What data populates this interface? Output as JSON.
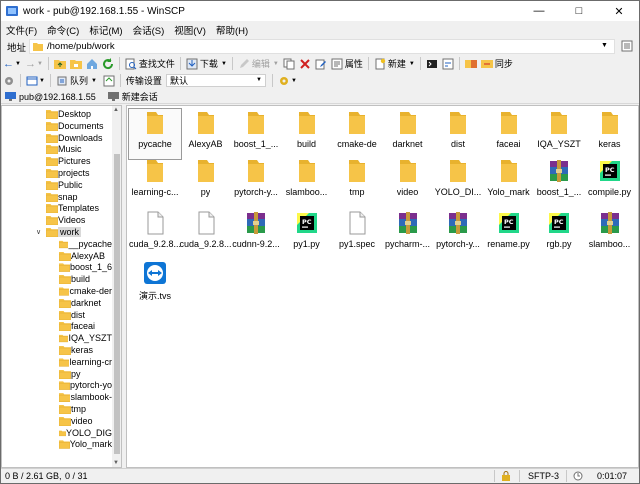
{
  "window": {
    "title": "work - pub@192.168.1.55 - WinSCP"
  },
  "menu": [
    "文件(F)",
    "命令(C)",
    "标记(M)",
    "会话(S)",
    "视图(V)",
    "帮助(H)"
  ],
  "address": {
    "label": "地址",
    "path": "/home/pub/work"
  },
  "toolbar1": {
    "find": "查找文件",
    "download": "下载",
    "edit": "编辑",
    "properties": "属性",
    "new": "新建",
    "sync": "同步"
  },
  "toolbar2": {
    "queue": "队列",
    "transfer_label": "传输设置",
    "transfer_value": "默认"
  },
  "session": {
    "current": "pub@192.168.1.55",
    "new": "新建会话"
  },
  "tree": {
    "top": [
      "Desktop",
      "Documents",
      "Downloads",
      "Music",
      "Pictures",
      "projects",
      "Public",
      "snap",
      "Templates",
      "Videos"
    ],
    "current": "work",
    "children": [
      "__pycache",
      "AlexyAB",
      "boost_1_6",
      "build",
      "cmake-der",
      "darknet",
      "dist",
      "faceai",
      "IQA_YSZT",
      "keras",
      "learning-cr",
      "py",
      "pytorch-yo",
      "slambook-",
      "tmp",
      "video",
      "YOLO_DIG",
      "Yolo_mark"
    ]
  },
  "files": [
    {
      "name": "pycache",
      "type": "folder"
    },
    {
      "name": "AlexyAB",
      "type": "folder"
    },
    {
      "name": "boost_1_...",
      "type": "folder"
    },
    {
      "name": "build",
      "type": "folder"
    },
    {
      "name": "cmake-de",
      "type": "folder"
    },
    {
      "name": "darknet",
      "type": "folder"
    },
    {
      "name": "dist",
      "type": "folder"
    },
    {
      "name": "faceai",
      "type": "folder"
    },
    {
      "name": "IQA_YSZT",
      "type": "folder"
    },
    {
      "name": "keras",
      "type": "folder"
    },
    {
      "name": "learning-c...",
      "type": "folder"
    },
    {
      "name": "py",
      "type": "folder"
    },
    {
      "name": "pytorch-y...",
      "type": "folder"
    },
    {
      "name": "slamboo...",
      "type": "folder"
    },
    {
      "name": "tmp",
      "type": "folder"
    },
    {
      "name": "video",
      "type": "folder"
    },
    {
      "name": "YOLO_DI...",
      "type": "folder"
    },
    {
      "name": "Yolo_mark",
      "type": "folder"
    },
    {
      "name": "boost_1_...",
      "type": "archive"
    },
    {
      "name": "compile.py",
      "type": "python"
    },
    {
      "name": "cuda_9.2.8...",
      "type": "doc"
    },
    {
      "name": "cuda_9.2.8...",
      "type": "doc"
    },
    {
      "name": "cudnn-9.2...",
      "type": "archive"
    },
    {
      "name": "py1.py",
      "type": "python"
    },
    {
      "name": "py1.spec",
      "type": "doc"
    },
    {
      "name": "pycharm-...",
      "type": "archive"
    },
    {
      "name": "pytorch-y...",
      "type": "archive"
    },
    {
      "name": "rename.py",
      "type": "python"
    },
    {
      "name": "rgb.py",
      "type": "python"
    },
    {
      "name": "slamboo...",
      "type": "archive"
    },
    {
      "name": "演示.tvs",
      "type": "teamviewer"
    }
  ],
  "status": {
    "size": "0 B / 2.61 GB,",
    "count": "0 / 31",
    "protocol": "SFTP-3",
    "time": "0:01:07"
  },
  "colors": {
    "folder": "#f6c448",
    "folder_dark": "#e0a82a",
    "accent": "#0a64c8"
  }
}
